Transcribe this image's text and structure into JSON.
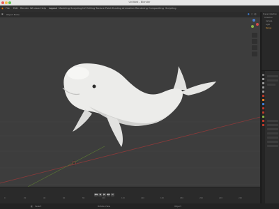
{
  "window": {
    "title": "Untitled - Blender"
  },
  "menubar": {
    "items": [
      "File",
      "Edit",
      "Render",
      "Window",
      "Help",
      "Layout",
      "Modeling",
      "Sculpting",
      "UV Editing",
      "Texture Paint",
      "Shading",
      "Animation",
      "Rendering",
      "Compositing",
      "Scripting"
    ]
  },
  "viewport": {
    "mode_label": "Object Mode",
    "object_name": "Beluga whale"
  },
  "timeline": {
    "frame_ticks": [
      "0",
      "20",
      "40",
      "60",
      "80",
      "100",
      "120",
      "140",
      "160",
      "180",
      "200",
      "220",
      "240"
    ],
    "buttons": [
      "◀◀",
      "◀",
      "▶",
      "▶▶",
      "⏭"
    ]
  },
  "statusbar": {
    "left_text": "Select",
    "middle_text": "Rotate View",
    "right_text": "Object"
  },
  "outliner": {
    "items": [
      "Scene Collection",
      "Collection",
      "Camera",
      "Light",
      "Beluga"
    ]
  },
  "colors": {
    "viewport_bg": "#3d3d3d",
    "accent_blue": "#3e7fd6",
    "axis_x": "#d24a4a",
    "axis_y": "#8ab546",
    "axis_z": "#4a7fd2",
    "whale_body": "#e8e8e6"
  },
  "icons": {
    "tabs": [
      "tool-icon",
      "render-icon",
      "output-icon",
      "view-layer-icon",
      "scene-icon",
      "world-icon",
      "object-icon",
      "modifier-icon",
      "particles-icon",
      "physics-icon",
      "constraints-icon",
      "data-icon",
      "material-icon"
    ]
  }
}
